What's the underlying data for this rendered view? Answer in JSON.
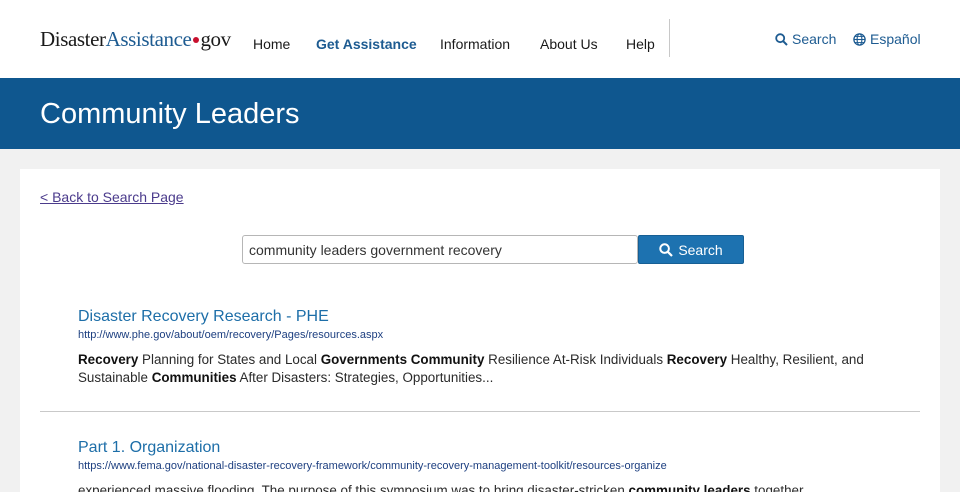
{
  "logo": {
    "part1": "Disaster",
    "part2": "Assistance",
    "part3": "gov"
  },
  "nav": {
    "items": [
      {
        "label": "Home",
        "active": false
      },
      {
        "label": "Get Assistance",
        "active": true
      },
      {
        "label": "Information",
        "active": false
      },
      {
        "label": "About Us",
        "active": false
      },
      {
        "label": "Help",
        "active": false
      }
    ]
  },
  "utility": {
    "search_label": "Search",
    "search_icon": "search-icon",
    "language_label": "Español",
    "language_icon": "globe-icon"
  },
  "banner": {
    "title": "Community Leaders"
  },
  "back_link": "< Back to Search Page",
  "search": {
    "query": "community leaders government recovery",
    "button_label": "Search"
  },
  "results": [
    {
      "title": "Disaster Recovery Research - PHE",
      "url": "http://www.phe.gov/about/oem/recovery/Pages/resources.aspx",
      "snippet": [
        {
          "text": "Recovery",
          "bold": true
        },
        {
          "text": " Planning for States and Local ",
          "bold": false
        },
        {
          "text": "Governments",
          "bold": true
        },
        {
          "text": " ",
          "bold": false
        },
        {
          "text": "Community",
          "bold": true
        },
        {
          "text": " Resilience At-Risk Individuals ",
          "bold": false
        },
        {
          "text": "Recovery",
          "bold": true
        },
        {
          "text": " Healthy, Resilient, and Sustainable ",
          "bold": false
        },
        {
          "text": "Communities",
          "bold": true
        },
        {
          "text": " After Disasters: Strategies, Opportunities...",
          "bold": false
        }
      ]
    },
    {
      "title": "Part 1. Organization",
      "url": "https://www.fema.gov/national-disaster-recovery-framework/community-recovery-management-toolkit/resources-organize",
      "snippet": [
        {
          "text": "experienced massive flooding. The purpose of this symposium was to bring disaster-stricken ",
          "bold": false
        },
        {
          "text": "community leaders",
          "bold": true
        },
        {
          "text": " together",
          "bold": false
        }
      ]
    }
  ],
  "colors": {
    "brand_blue": "#0f578f",
    "link_blue": "#1d6ea8",
    "button_blue": "#1d72b0",
    "logo_dot_red": "#c8102e"
  }
}
